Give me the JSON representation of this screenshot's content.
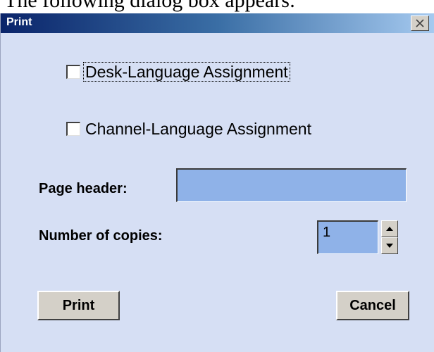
{
  "background_text": "The following dialog box appears:",
  "dialog": {
    "title": "Print",
    "close_icon": "close-icon"
  },
  "checkboxes": [
    {
      "label": "Desk-Language Assignment",
      "checked": false,
      "focused": true
    },
    {
      "label": "Channel-Language Assignment",
      "checked": false,
      "focused": false
    }
  ],
  "page_header": {
    "label": "Page header:",
    "value": ""
  },
  "copies": {
    "label": "Number of copies:",
    "value": "1"
  },
  "buttons": {
    "print": "Print",
    "cancel": "Cancel"
  },
  "colors": {
    "dialog_bg": "#d6dff4",
    "input_bg": "#8fb2e8",
    "title_start": "#0a246a"
  }
}
